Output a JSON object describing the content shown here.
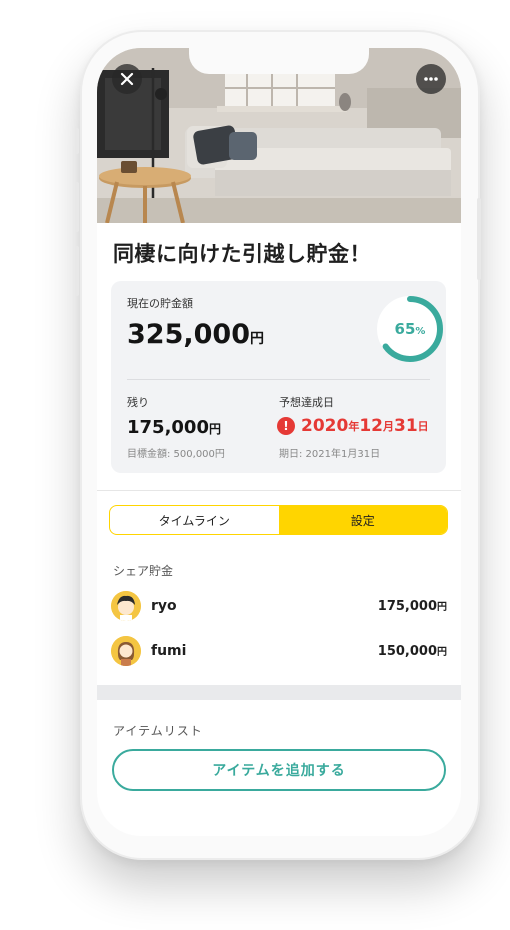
{
  "header": {
    "close_icon": "close-icon",
    "more_icon": "more-icon"
  },
  "goal": {
    "title": "同棲に向けた引越し貯金！"
  },
  "summary": {
    "current_label": "現在の貯金額",
    "current_amount": "325,000",
    "current_unit": "円",
    "progress_value": "65",
    "progress_unit": "%",
    "progress_fraction": 0.65,
    "remaining_label": "残り",
    "remaining_amount": "175,000",
    "remaining_unit": "円",
    "target_label": "目標金額: 500,000円",
    "forecast_label": "予想達成日",
    "forecast_year": "2020",
    "forecast_year_unit": "年",
    "forecast_month": "12",
    "forecast_month_unit": "月",
    "forecast_day": "31",
    "forecast_day_unit": "日",
    "deadline_label": "期日: 2021年1月31日",
    "accent_color": "#3aaa9d",
    "warning_color": "#e53935"
  },
  "tabs": [
    {
      "label": "タイムライン",
      "active": false
    },
    {
      "label": "設定",
      "active": true
    }
  ],
  "share": {
    "section_label": "シェア貯金",
    "members": [
      {
        "name": "ryo",
        "amount": "175,000",
        "unit": "円"
      },
      {
        "name": "fumi",
        "amount": "150,000",
        "unit": "円"
      }
    ]
  },
  "items": {
    "section_label": "アイテムリスト",
    "add_button": "アイテムを追加する"
  },
  "colors": {
    "tab_yellow": "#ffd500",
    "teal": "#3aaa9d"
  }
}
